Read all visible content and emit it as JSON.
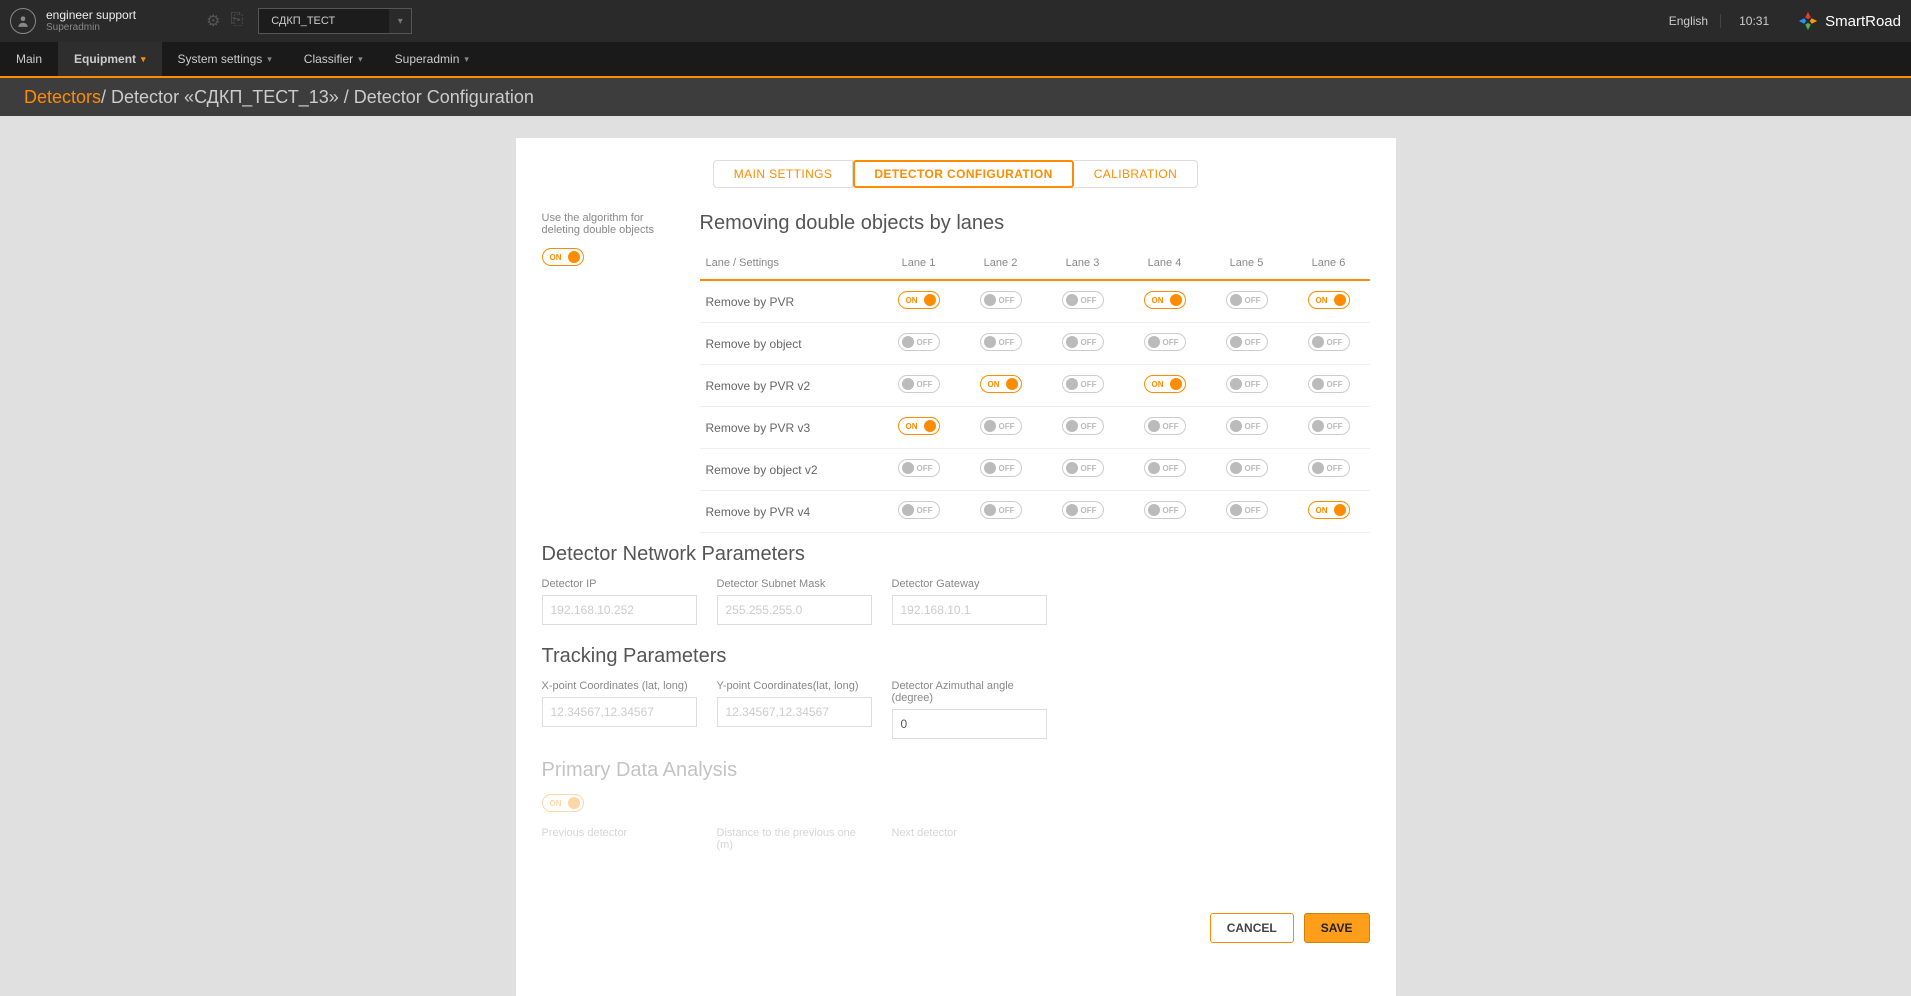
{
  "header": {
    "username": "engineer support",
    "role": "Superadmin",
    "dropdown": "СДКП_ТЕСТ",
    "language": "English",
    "time": "10:31",
    "brand": "SmartRoad"
  },
  "menu": {
    "items": [
      {
        "label": "Main",
        "chev": false,
        "active": false
      },
      {
        "label": "Equipment",
        "chev": true,
        "active": true
      },
      {
        "label": "System settings",
        "chev": true,
        "active": false
      },
      {
        "label": "Classifier",
        "chev": true,
        "active": false
      },
      {
        "label": "Superadmin",
        "chev": true,
        "active": false
      }
    ]
  },
  "breadcrumb": {
    "root": "Detectors",
    "rest": " / Detector «СДКП_ТЕСТ_13» / Detector Configuration"
  },
  "tabs": {
    "main": "MAIN SETTINGS",
    "config": "DETECTOR CONFIGURATION",
    "calib": "CALIBRATION"
  },
  "algo": {
    "label": "Use the algorithm for deleting double objects",
    "state": "on"
  },
  "table": {
    "title": "Removing double objects by lanes",
    "header_settings": "Lane / Settings",
    "lane_labels": [
      "Lane 1",
      "Lane 2",
      "Lane 3",
      "Lane 4",
      "Lane 5",
      "Lane 6"
    ],
    "rows": [
      {
        "label": "Remove by PVR",
        "states": [
          "on",
          "off",
          "off",
          "on",
          "off",
          "on"
        ]
      },
      {
        "label": "Remove by object",
        "states": [
          "off",
          "off",
          "off",
          "off",
          "off",
          "off"
        ]
      },
      {
        "label": "Remove by PVR v2",
        "states": [
          "off",
          "on",
          "off",
          "on",
          "off",
          "off"
        ]
      },
      {
        "label": "Remove by PVR v3",
        "states": [
          "on",
          "off",
          "off",
          "off",
          "off",
          "off"
        ]
      },
      {
        "label": "Remove by object v2",
        "states": [
          "off",
          "off",
          "off",
          "off",
          "off",
          "off"
        ]
      },
      {
        "label": "Remove by PVR v4",
        "states": [
          "off",
          "off",
          "off",
          "off",
          "off",
          "on"
        ]
      }
    ]
  },
  "network": {
    "title": "Detector Network Parameters",
    "ip_label": "Detector IP",
    "ip_ph": "192.168.10.252",
    "mask_label": "Detector Subnet Mask",
    "mask_ph": "255.255.255.0",
    "gw_label": "Detector Gateway",
    "gw_ph": "192.168.10.1"
  },
  "tracking": {
    "title": "Tracking Parameters",
    "x_label": "X-point Coordinates (lat, long)",
    "x_ph": "12.34567,12.34567",
    "y_label": "Y-point Coordinates(lat, long)",
    "y_ph": "12.34567,12.34567",
    "az_label": "Detector Azimuthal angle (degree)",
    "az_val": "0"
  },
  "primary": {
    "title": "Primary Data Analysis",
    "state": "on",
    "prev_label": "Previous detector",
    "dist_label": "Distance to the previous one (m)",
    "next_label": "Next detector"
  },
  "buttons": {
    "cancel": "CANCEL",
    "save": "SAVE"
  },
  "toggle_text": {
    "on": "ON",
    "off": "OFF"
  }
}
